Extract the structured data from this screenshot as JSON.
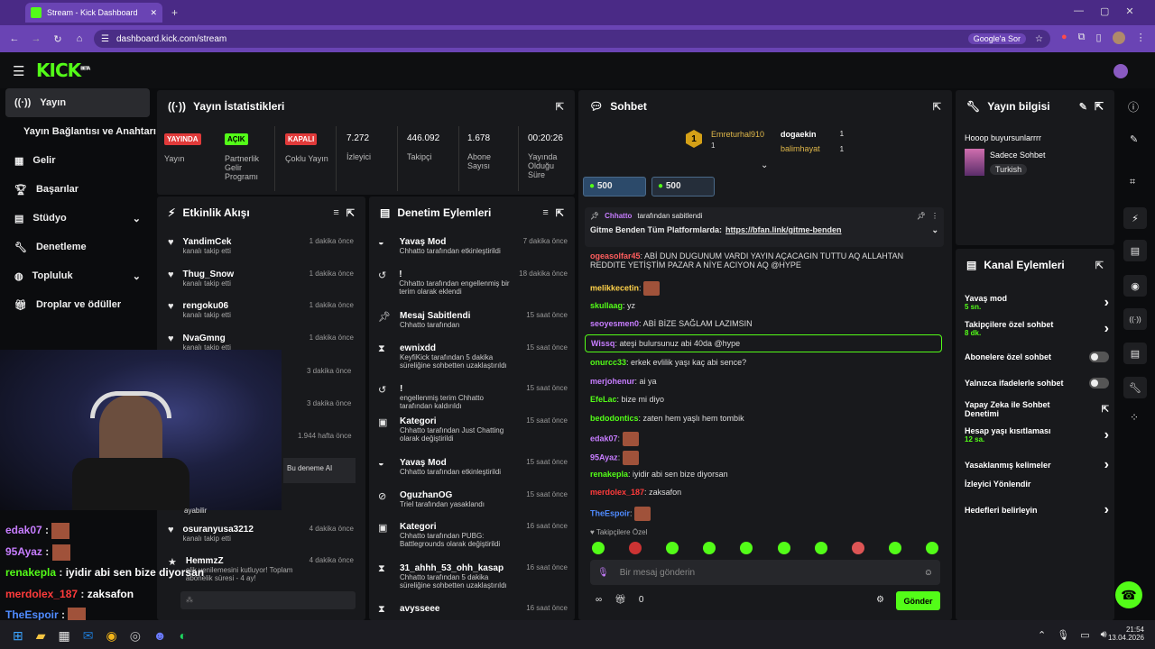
{
  "browser": {
    "tab_title": "Stream - Kick Dashboard",
    "url": "dashboard.kick.com/stream",
    "google_btn": "Google'a Sor"
  },
  "brand": {
    "logo": "KICK",
    "beta": "BETA"
  },
  "sidebar": {
    "items": [
      {
        "label": "Yayın",
        "icon": "broadcast-icon"
      },
      {
        "label": "Yayın Bağlantısı ve Anahtarı"
      },
      {
        "label": "Gelir",
        "icon": "chart-icon"
      },
      {
        "label": "Başarılar",
        "icon": "trophy-icon"
      },
      {
        "label": "Stüdyo",
        "icon": "studio-icon"
      },
      {
        "label": "Denetleme",
        "icon": "wrench-icon"
      },
      {
        "label": "Topluluk",
        "icon": "users-icon"
      },
      {
        "label": "Droplar ve ödüller",
        "icon": "gift-icon"
      }
    ]
  },
  "stats": {
    "title": "Yayın İstatistikleri",
    "items": [
      {
        "badge": "YAYINDA",
        "label": "Yayın"
      },
      {
        "badge": "AÇIK",
        "label": "Partnerlik Gelir Programı"
      },
      {
        "badge": "KAPALI",
        "label": "Çoklu Yayın"
      },
      {
        "value": "7.272",
        "label": "İzleyici"
      },
      {
        "value": "446.092",
        "label": "Takipçi"
      },
      {
        "value": "1.678",
        "label": "Abone Sayısı"
      },
      {
        "value": "00:20:26",
        "label": "Yayında Olduğu Süre"
      }
    ]
  },
  "feed": {
    "title": "Etkinlik Akışı",
    "items": [
      {
        "name": "YandimCek",
        "sub": "kanalı takip etti",
        "time": "1 dakika önce"
      },
      {
        "name": "Thug_Snow",
        "sub": "kanalı takip etti",
        "time": "1 dakika önce"
      },
      {
        "name": "rengoku06",
        "sub": "kanalı takip etti",
        "time": "1 dakika önce"
      },
      {
        "name": "NvaGmng",
        "sub": "kanalı takip etti",
        "time": "1 dakika önce"
      },
      {
        "name": "",
        "sub": "",
        "time": "3 dakika önce"
      },
      {
        "name": "",
        "sub": "",
        "time": "3 dakika önce"
      },
      {
        "name": "",
        "sub": "",
        "time": "1.944 hafta önce"
      },
      {
        "name": "osuranyusa3212",
        "sub": "kanalı takip etti",
        "time": "4 dakika önce"
      },
      {
        "name": "HemmzZ",
        "sub": "elik yenilemesini kutluyor! Toplam abonelik süresi - 4 ay!",
        "time": "4 dakika önce"
      }
    ],
    "ai_note": "Bu deneme AI",
    "ai_bar": "ayabilir"
  },
  "mod": {
    "title": "Denetim Eylemleri",
    "items": [
      {
        "title": "Yavaş Mod",
        "sub": "Chhatto tarafından etkinleştirildi",
        "time": "7 dakika önce",
        "icon": "slow-icon"
      },
      {
        "title": "!",
        "sub": "Chhatto tarafından engellenmiş bir terim olarak eklendi",
        "time": "18 dakika önce",
        "icon": "undo-icon"
      },
      {
        "title": "Mesaj Sabitlendi",
        "sub": "Chhatto tarafından",
        "time": "15 saat önce",
        "icon": "pin-icon"
      },
      {
        "title": "ewnixdd",
        "sub": "KeyfiKick tarafından 5 dakika süreliğine sohbetten uzaklaştırıldı",
        "time": "15 saat önce",
        "icon": "hourglass-icon"
      },
      {
        "title": "!",
        "sub": "engellenmiş terim Chhatto tarafından kaldırıldı",
        "time": "15 saat önce",
        "icon": "undo-icon"
      },
      {
        "title": "Kategori",
        "sub": "Chhatto tarafından Just Chatting olarak değiştirildi",
        "time": "15 saat önce",
        "icon": "category-icon"
      },
      {
        "title": "Yavaş Mod",
        "sub": "Chhatto tarafından etkinleştirildi",
        "time": "15 saat önce",
        "icon": "slow-icon"
      },
      {
        "title": "OguzhanOG",
        "sub": "Triel tarafından yasaklandı",
        "time": "15 saat önce",
        "icon": "ban-icon"
      },
      {
        "title": "Kategori",
        "sub": "Chhatto tarafından PUBG: Battlegrounds olarak değiştirildi",
        "time": "16 saat önce",
        "icon": "category-icon"
      },
      {
        "title": "31_ahhh_53_ohh_kasap",
        "sub": "Chhatto tarafından 5 dakika süreliğine sohbetten uzaklaştırıldı",
        "time": "16 saat önce",
        "icon": "hourglass-icon"
      },
      {
        "title": "avysseee",
        "sub": "",
        "time": "16 saat önce",
        "icon": "hourglass-icon"
      }
    ]
  },
  "chat": {
    "title": "Sohbet",
    "leaders": [
      {
        "name": "Emreturhal910",
        "count": "1"
      },
      {
        "name": "dogaekin",
        "count": "1"
      },
      {
        "name": "balimhayat",
        "count": "1"
      }
    ],
    "rank": "1",
    "goals": [
      {
        "value": "500"
      },
      {
        "value": "500"
      }
    ],
    "pinned": {
      "by": "Chhatto",
      "by_suffix": "tarafından sabitlendi",
      "text": "Gitme Benden Tüm Platformlarda:",
      "link": "https://bfan.link/gitme-benden"
    },
    "messages": [
      {
        "user": "ogeasolfar45",
        "text": "ABİ DUN DUGUNUM VARDI YAYIN AÇACAGIN TUTTU AQ ALLAHTAN REDDITE YETİŞTİM PAZAR A NİYE ACIYON AQ @HYPE",
        "color": "#ff5e5e"
      },
      {
        "user": "melikkecetin",
        "text": "",
        "color": "#ffd24a"
      },
      {
        "user": "skullaag",
        "text": "yz",
        "color": "#53fc18"
      },
      {
        "user": "seoyesmen0",
        "text": "ABİ BİZE SAĞLAM LAZIMSIN",
        "color": "#c77dff"
      },
      {
        "user": "Wissq",
        "text": "ateşi bulursunuz abi 40da @hype",
        "color": "#c77dff"
      },
      {
        "user": "onurcc33",
        "text": "erkek evlilik yaşı kaç abi sence?",
        "color": "#53fc18"
      },
      {
        "user": "merjohenur",
        "text": "ai ya",
        "color": "#c77dff"
      },
      {
        "user": "EfeLac",
        "text": "bize mi diyo",
        "color": "#53fc18"
      },
      {
        "user": "bedodontics",
        "text": "zaten hem yaşlı hem tombik",
        "color": "#53fc18"
      },
      {
        "user": "edak07",
        "text": "",
        "color": "#c77dff"
      },
      {
        "user": "95Ayaz",
        "text": "",
        "color": "#c77dff"
      },
      {
        "user": "renakepla",
        "text": "iyidir abi sen bize diyorsan",
        "color": "#53fc18"
      },
      {
        "user": "merdolex_187",
        "text": "zaksafon",
        "color": "#ff3b3b"
      },
      {
        "user": "TheEspoir",
        "text": "",
        "color": "#4f8bff"
      }
    ],
    "followers_only": "Takipçilere Özel",
    "input_placeholder": "Bir mesaj gönderin",
    "coins": "0",
    "send": "Gönder"
  },
  "info": {
    "title": "Yayın bilgisi",
    "stream_title": "Hooop buyursunlarrrr",
    "category": "Sadece Sohbet",
    "tag": "Turkish"
  },
  "channel": {
    "title": "Kanal Eylemleri",
    "items": [
      {
        "label": "Yavaş mod",
        "sub": "5 sn.",
        "type": "chevron"
      },
      {
        "label": "Takipçilere özel sohbet",
        "sub": "8 dk.",
        "type": "chevron"
      },
      {
        "label": "Abonelere özel sohbet",
        "sub": "",
        "type": "toggle"
      },
      {
        "label": "Yalnızca ifadelerle sohbet",
        "sub": "",
        "type": "toggle"
      },
      {
        "label": "Yapay Zeka ile Sohbet Denetimi",
        "sub": "",
        "type": "external"
      },
      {
        "label": "Hesap yaşı kısıtlaması",
        "sub": "12 sa.",
        "type": "chevron"
      },
      {
        "label": "Yasaklanmış kelimeler",
        "sub": "",
        "type": "chevron"
      },
      {
        "label": "İzleyici Yönlendir",
        "sub": "",
        "type": "none"
      },
      {
        "label": "Hedefleri belirleyin",
        "sub": "",
        "type": "chevron"
      }
    ]
  },
  "overlay_chat": [
    {
      "user": "edak07",
      "text": "",
      "color": "#c77dff"
    },
    {
      "user": "95Ayaz",
      "text": "",
      "color": "#c77dff"
    },
    {
      "user": "renakepla",
      "text": "iyidir abi sen bize diyorsan",
      "color": "#53fc18"
    },
    {
      "user": "merdolex_187",
      "text": "zaksafon",
      "color": "#ff3b3b"
    },
    {
      "user": "TheEspoir",
      "text": "",
      "color": "#4f8bff"
    }
  ],
  "taskbar": {
    "time": "21:54",
    "date": "13.04.2026"
  },
  "colors": {
    "accent": "#53fc18",
    "panel": "#18191c",
    "browser": "#6a44b4"
  }
}
